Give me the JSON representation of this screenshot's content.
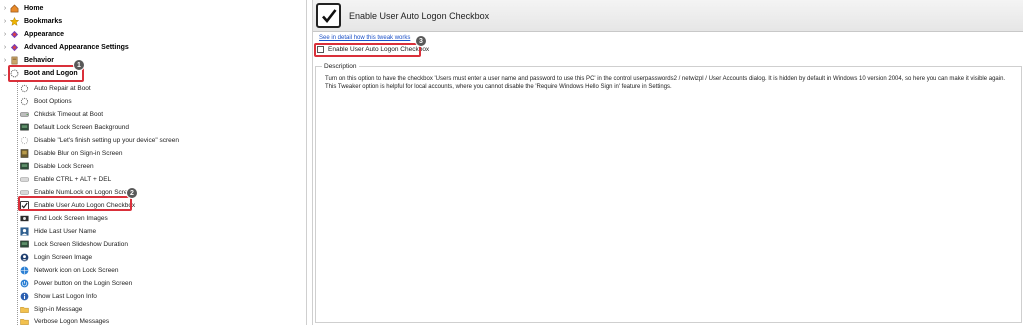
{
  "tree": {
    "top_items": [
      {
        "label": "Home",
        "arrow": "›",
        "icon": "home-icon"
      },
      {
        "label": "Bookmarks",
        "arrow": "›",
        "icon": "star-icon"
      },
      {
        "label": "Appearance",
        "arrow": "›",
        "icon": "appearance-icon"
      },
      {
        "label": "Advanced Appearance Settings",
        "arrow": "›",
        "icon": "advanced-appearance-icon"
      },
      {
        "label": "Behavior",
        "arrow": "›",
        "icon": "behavior-icon"
      },
      {
        "label": "Boot and Logon",
        "arrow": "⌄",
        "icon": "boot-logon-icon"
      }
    ],
    "children": [
      {
        "label": "Auto Repair at Boot",
        "icon": "spinner-icon"
      },
      {
        "label": "Boot Options",
        "icon": "spinner-icon"
      },
      {
        "label": "Chkdsk Timeout at Boot",
        "icon": "drive-icon"
      },
      {
        "label": "Default Lock Screen Background",
        "icon": "monitor-icon"
      },
      {
        "label": "Disable \"Let's finish setting up your device\" screen",
        "icon": "spinner-icon"
      },
      {
        "label": "Disable Blur on Sign-in Screen",
        "icon": "image-icon"
      },
      {
        "label": "Disable Lock Screen",
        "icon": "monitor-icon"
      },
      {
        "label": "Enable CTRL + ALT + DEL",
        "icon": "keyboard-icon"
      },
      {
        "label": "Enable NumLock on Logon Screen",
        "icon": "keyboard-icon"
      },
      {
        "label": "Enable User Auto Logon Checkbox",
        "icon": "checkbox-icon"
      },
      {
        "label": "Find Lock Screen Images",
        "icon": "camera-icon"
      },
      {
        "label": "Hide Last User Name",
        "icon": "user-icon"
      },
      {
        "label": "Lock Screen Slideshow Duration",
        "icon": "monitor-icon"
      },
      {
        "label": "Login Screen Image",
        "icon": "user-image-icon"
      },
      {
        "label": "Network icon on Lock Screen",
        "icon": "network-icon"
      },
      {
        "label": "Power button on the Login Screen",
        "icon": "power-icon"
      },
      {
        "label": "Show Last Logon Info",
        "icon": "info-icon"
      },
      {
        "label": "Sign-in Message",
        "icon": "folder-icon"
      },
      {
        "label": "Verbose Logon Messages",
        "icon": "folder-icon"
      }
    ]
  },
  "badges": {
    "one": "1",
    "two": "2",
    "three": "3"
  },
  "panel": {
    "title": "Enable User Auto Logon Checkbox",
    "link": "See in detail how this tweak works",
    "checkbox_label": "Enable User Auto Logon Checkbox",
    "checkbox_checked": false,
    "description_legend": "Description",
    "description_line1": "Turn on this option to have the checkbox 'Users must enter a user name and password to use this PC' in the control userpasswords2 / netwiz​pl / User Accounts dialog. It is hidden by default in Windows 10 version 2004, so here you can make it visible again.",
    "description_line2": "This Tweaker option is helpful for local accounts, where you cannot disable the 'Require Windows Hello Sign in' feature in Settings."
  },
  "colors": {
    "highlight": "#d9303a",
    "badge": "#595959",
    "link": "#1a4fc7"
  }
}
